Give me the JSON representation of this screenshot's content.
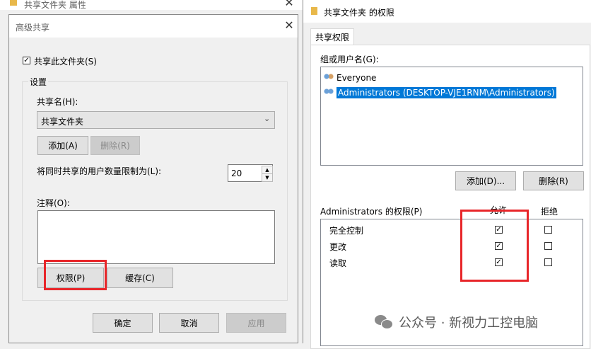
{
  "bg_window": {
    "title": "共享文件夹 属性"
  },
  "advanced": {
    "title": "高级共享",
    "share_checkbox_label": "共享此文件夹(S)",
    "share_checked": true,
    "settings_group_label": "设置",
    "share_name_label": "共享名(H):",
    "share_name_value": "共享文件夹",
    "add_button": "添加(A)",
    "delete_button": "删除(R)",
    "limit_label": "将同时共享的用户数量限制为(L):",
    "limit_value": "20",
    "comment_label": "注释(O):",
    "permissions_button": "权限(P)",
    "cache_button": "缓存(C)",
    "ok_button": "确定",
    "cancel_button": "取消",
    "apply_button": "应用"
  },
  "permissions": {
    "title": "共享文件夹 的权限",
    "tab_label": "共享权限",
    "group_label": "组或用户名(G):",
    "users": [
      {
        "name": "Everyone",
        "selected": false
      },
      {
        "name": "Administrators (DESKTOP-VJE1RNM\\Administrators)",
        "selected": true
      }
    ],
    "add_button": "添加(D)...",
    "delete_button": "删除(R)",
    "perms_header": "Administrators 的权限(P)",
    "allow_header": "允许",
    "deny_header": "拒绝",
    "rows": [
      {
        "name": "完全控制",
        "allow": true,
        "deny": false
      },
      {
        "name": "更改",
        "allow": true,
        "deny": false
      },
      {
        "name": "读取",
        "allow": true,
        "deny": false
      }
    ]
  },
  "watermark": {
    "text": "公众号 · 新视力工控电脑"
  },
  "colors": {
    "highlight_red": "#e8262a",
    "selection_blue": "#0078d7"
  }
}
